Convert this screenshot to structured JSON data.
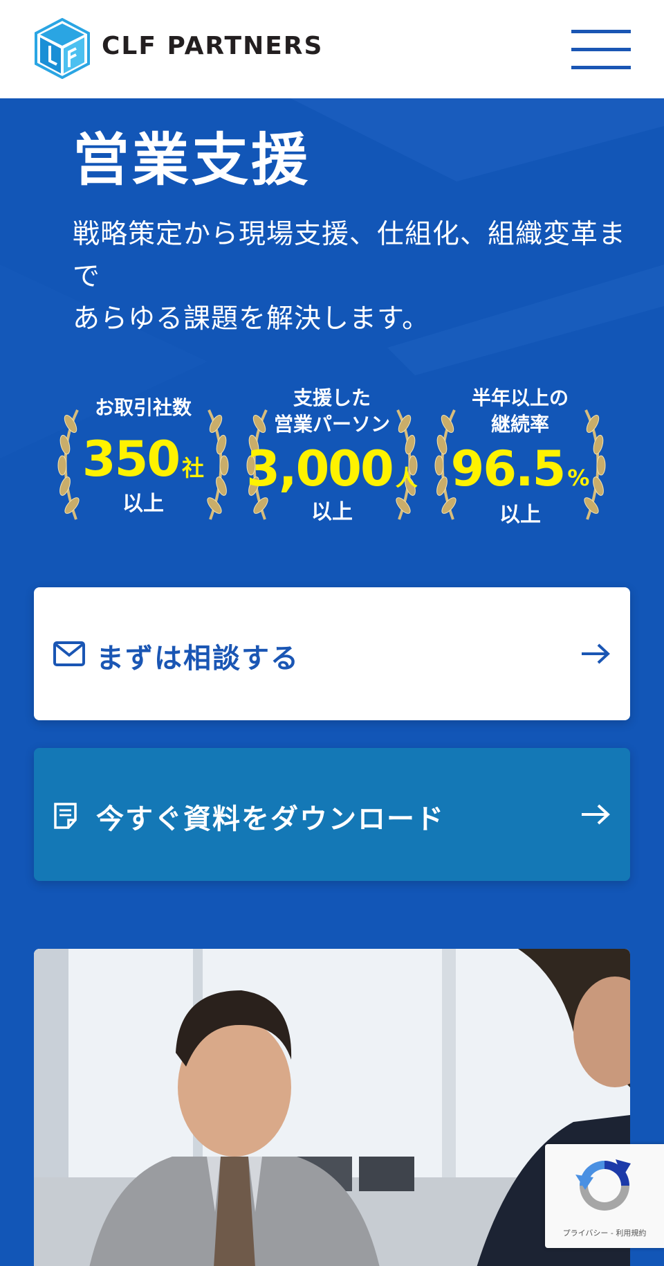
{
  "header": {
    "brand": "CLF PARTNERS",
    "logo_icon": "cube-logo-icon",
    "menu_icon": "hamburger-menu-icon"
  },
  "hero": {
    "title": "営業支援",
    "lead_lines": [
      "戦略策定から現場支援、仕組化、組織変革ま",
      "で",
      "あらゆる課題を解決します。"
    ]
  },
  "stats": [
    {
      "caption_lines": [
        "お取引社数"
      ],
      "value": "350",
      "unit": "社",
      "suffix": "以上"
    },
    {
      "caption_lines": [
        "支援した",
        "営業パーソン"
      ],
      "value": "3,000",
      "unit": "人",
      "suffix": "以上"
    },
    {
      "caption_lines": [
        "半年以上の",
        "継続率"
      ],
      "value": "96.5",
      "unit": "%",
      "suffix": "以上"
    }
  ],
  "buttons": {
    "consult": {
      "label": "まずは相談する",
      "icon": "mail-icon",
      "arrow_icon": "arrow-right-icon"
    },
    "download": {
      "label": "今すぐ資料をダウンロード",
      "icon": "document-icon",
      "arrow_icon": "arrow-right-icon"
    }
  },
  "recaptcha": {
    "text": "プライバシー - 利用規約",
    "icon": "recaptcha-icon"
  },
  "colors": {
    "brand_blue": "#1256b7",
    "accent_yellow": "#fff200",
    "download_button": "#1478b6",
    "text_dark": "#231f20"
  }
}
